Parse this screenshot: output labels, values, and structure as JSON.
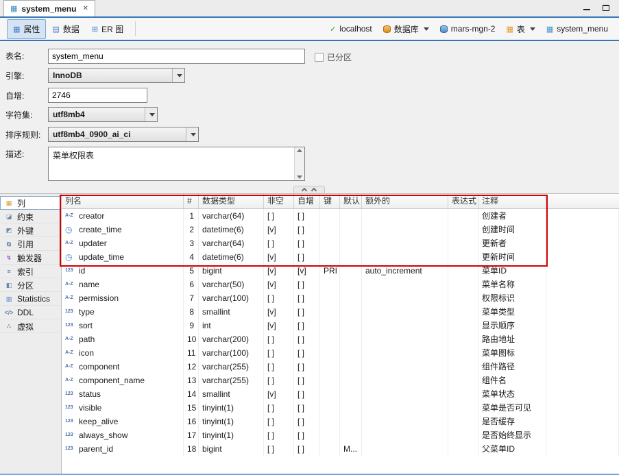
{
  "window": {
    "tab_title": "system_menu"
  },
  "icons": {
    "close": "✕",
    "table-icon": "▦",
    "properties-icon": "▦",
    "data-icon": "▤",
    "er-diagram-icon": "⊞",
    "connection-icon": "✓",
    "tables-icon": "▦",
    "columns-icon": "▦",
    "constraints-icon": "◪",
    "foreign-keys-icon": "◩",
    "references-icon": "⧉",
    "triggers-icon": "↯",
    "indexes-icon": "≡",
    "partitions-icon": "◧",
    "statistics-icon": "▥",
    "ddl-icon": "</>",
    "virtual-icon": "∴",
    "string-icon": "A-Z",
    "number-icon": "123",
    "datetime-icon": "◷"
  },
  "toolbar": {
    "tabs": [
      {
        "id": "properties",
        "label": "属性",
        "icon": "properties-icon",
        "active": true
      },
      {
        "id": "data",
        "label": "数据",
        "icon": "data-icon",
        "active": false
      },
      {
        "id": "er-diagram",
        "label": "ER 图",
        "icon": "er-diagram-icon",
        "active": false
      }
    ],
    "breadcrumbs": [
      {
        "id": "connection",
        "label": "localhost",
        "icon": "connection-icon",
        "dropdown": false
      },
      {
        "id": "database-selector",
        "label": "数据库",
        "icon": "database-icon",
        "dropdown": true
      },
      {
        "id": "schema",
        "label": "mars-mgn-2",
        "icon": "schema-icon",
        "dropdown": false
      },
      {
        "id": "table-selector",
        "label": "表",
        "icon": "tables-icon",
        "dropdown": true
      },
      {
        "id": "table",
        "label": "system_menu",
        "icon": "table-icon",
        "dropdown": false
      }
    ]
  },
  "form": {
    "table_name": {
      "label": "表名:",
      "value": "system_menu"
    },
    "partitioned": {
      "label": "已分区",
      "checked": false
    },
    "engine": {
      "label": "引擎:",
      "value": "InnoDB"
    },
    "auto_increment": {
      "label": "自增:",
      "value": "2746"
    },
    "charset": {
      "label": "字符集:",
      "value": "utf8mb4"
    },
    "collation": {
      "label": "排序规则:",
      "value": "utf8mb4_0900_ai_ci"
    },
    "description": {
      "label": "描述:",
      "value": "菜单权限表"
    }
  },
  "sidebar": {
    "items": [
      {
        "id": "columns",
        "label": "列",
        "icon": "columns-icon",
        "selected": true
      },
      {
        "id": "constraints",
        "label": "约束",
        "icon": "constraints-icon",
        "selected": false
      },
      {
        "id": "foreign-keys",
        "label": "外键",
        "icon": "foreign-keys-icon",
        "selected": false
      },
      {
        "id": "references",
        "label": "引用",
        "icon": "references-icon",
        "selected": false
      },
      {
        "id": "triggers",
        "label": "触发器",
        "icon": "triggers-icon",
        "selected": false
      },
      {
        "id": "indexes",
        "label": "索引",
        "icon": "indexes-icon",
        "selected": false
      },
      {
        "id": "partitions",
        "label": "分区",
        "icon": "partitions-icon",
        "selected": false
      },
      {
        "id": "statistics",
        "label": "Statistics",
        "icon": "statistics-icon",
        "selected": false
      },
      {
        "id": "ddl",
        "label": "DDL",
        "icon": "ddl-icon",
        "selected": false
      },
      {
        "id": "virtual",
        "label": "虚拟",
        "icon": "virtual-icon",
        "selected": false
      }
    ]
  },
  "grid": {
    "columns": [
      "列名",
      "#",
      "数据类型",
      "非空",
      "自增",
      "键",
      "默认",
      "额外的",
      "表达式",
      "注释"
    ],
    "rows": [
      {
        "icon": "string",
        "name": "creator",
        "num": "1",
        "type": "varchar(64)",
        "not_null": "[ ]",
        "auto": "[ ]",
        "key": "",
        "def": "",
        "extra": "",
        "expr": "",
        "comment": "创建者"
      },
      {
        "icon": "datetime",
        "name": "create_time",
        "num": "2",
        "type": "datetime(6)",
        "not_null": "[v]",
        "auto": "[ ]",
        "key": "",
        "def": "",
        "extra": "",
        "expr": "",
        "comment": "创建时间"
      },
      {
        "icon": "string",
        "name": "updater",
        "num": "3",
        "type": "varchar(64)",
        "not_null": "[ ]",
        "auto": "[ ]",
        "key": "",
        "def": "",
        "extra": "",
        "expr": "",
        "comment": "更新者"
      },
      {
        "icon": "datetime",
        "name": "update_time",
        "num": "4",
        "type": "datetime(6)",
        "not_null": "[v]",
        "auto": "[ ]",
        "key": "",
        "def": "",
        "extra": "",
        "expr": "",
        "comment": "更新时间"
      },
      {
        "icon": "number",
        "name": "id",
        "num": "5",
        "type": "bigint",
        "not_null": "[v]",
        "auto": "[v]",
        "key": "PRI",
        "def": "",
        "extra": "auto_increment",
        "expr": "",
        "comment": "菜单ID"
      },
      {
        "icon": "string",
        "name": "name",
        "num": "6",
        "type": "varchar(50)",
        "not_null": "[v]",
        "auto": "[ ]",
        "key": "",
        "def": "",
        "extra": "",
        "expr": "",
        "comment": "菜单名称"
      },
      {
        "icon": "string",
        "name": "permission",
        "num": "7",
        "type": "varchar(100)",
        "not_null": "[ ]",
        "auto": "[ ]",
        "key": "",
        "def": "",
        "extra": "",
        "expr": "",
        "comment": "权限标识"
      },
      {
        "icon": "number",
        "name": "type",
        "num": "8",
        "type": "smallint",
        "not_null": "[v]",
        "auto": "[ ]",
        "key": "",
        "def": "",
        "extra": "",
        "expr": "",
        "comment": "菜单类型"
      },
      {
        "icon": "number",
        "name": "sort",
        "num": "9",
        "type": "int",
        "not_null": "[v]",
        "auto": "[ ]",
        "key": "",
        "def": "",
        "extra": "",
        "expr": "",
        "comment": "显示顺序"
      },
      {
        "icon": "string",
        "name": "path",
        "num": "10",
        "type": "varchar(200)",
        "not_null": "[ ]",
        "auto": "[ ]",
        "key": "",
        "def": "",
        "extra": "",
        "expr": "",
        "comment": "路由地址"
      },
      {
        "icon": "string",
        "name": "icon",
        "num": "11",
        "type": "varchar(100)",
        "not_null": "[ ]",
        "auto": "[ ]",
        "key": "",
        "def": "",
        "extra": "",
        "expr": "",
        "comment": "菜单图标"
      },
      {
        "icon": "string",
        "name": "component",
        "num": "12",
        "type": "varchar(255)",
        "not_null": "[ ]",
        "auto": "[ ]",
        "key": "",
        "def": "",
        "extra": "",
        "expr": "",
        "comment": "组件路径"
      },
      {
        "icon": "string",
        "name": "component_name",
        "num": "13",
        "type": "varchar(255)",
        "not_null": "[ ]",
        "auto": "[ ]",
        "key": "",
        "def": "",
        "extra": "",
        "expr": "",
        "comment": "组件名"
      },
      {
        "icon": "number",
        "name": "status",
        "num": "14",
        "type": "smallint",
        "not_null": "[v]",
        "auto": "[ ]",
        "key": "",
        "def": "",
        "extra": "",
        "expr": "",
        "comment": "菜单状态"
      },
      {
        "icon": "number",
        "name": "visible",
        "num": "15",
        "type": "tinyint(1)",
        "not_null": "[ ]",
        "auto": "[ ]",
        "key": "",
        "def": "",
        "extra": "",
        "expr": "",
        "comment": "菜单是否可见"
      },
      {
        "icon": "number",
        "name": "keep_alive",
        "num": "16",
        "type": "tinyint(1)",
        "not_null": "[ ]",
        "auto": "[ ]",
        "key": "",
        "def": "",
        "extra": "",
        "expr": "",
        "comment": "是否缓存"
      },
      {
        "icon": "number",
        "name": "always_show",
        "num": "17",
        "type": "tinyint(1)",
        "not_null": "[ ]",
        "auto": "[ ]",
        "key": "",
        "def": "",
        "extra": "",
        "expr": "",
        "comment": "是否始终显示"
      },
      {
        "icon": "number",
        "name": "parent_id",
        "num": "18",
        "type": "bigint",
        "not_null": "[ ]",
        "auto": "[ ]",
        "key": "",
        "def": "M...",
        "extra": "",
        "expr": "",
        "comment": "父菜单ID"
      }
    ]
  },
  "annotation": {
    "color": "#d10000"
  }
}
